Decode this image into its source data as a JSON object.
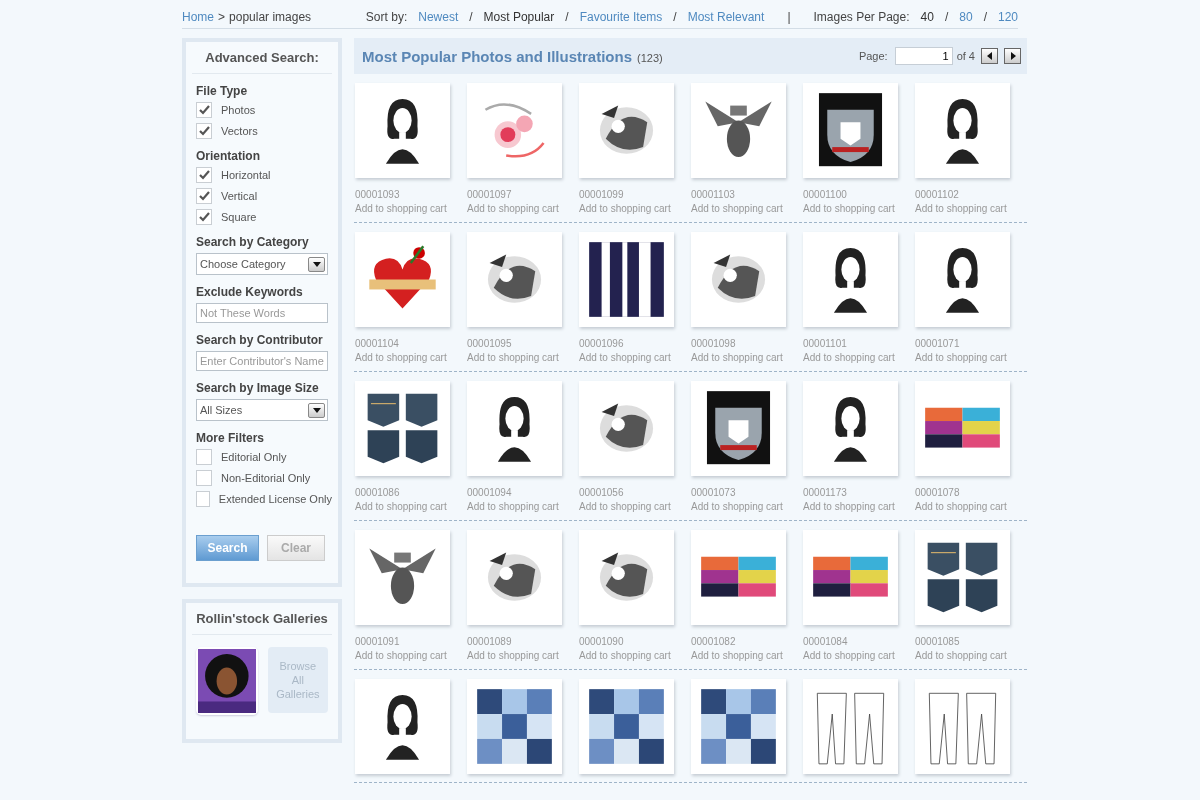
{
  "breadcrumb": {
    "home": "Home",
    "separator": ">",
    "current": "popular images"
  },
  "sort": {
    "label": "Sort by:",
    "separator": "/",
    "options": [
      {
        "label": "Newest",
        "selected": false
      },
      {
        "label": "Most Popular",
        "selected": true
      },
      {
        "label": "Favourite Items",
        "selected": false
      },
      {
        "label": "Most Relevant",
        "selected": false
      }
    ]
  },
  "divider": "|",
  "per_page": {
    "label": "Images Per Page:",
    "separator": "/",
    "options": [
      {
        "label": "40",
        "selected": true
      },
      {
        "label": "80",
        "selected": false
      },
      {
        "label": "120",
        "selected": false
      }
    ]
  },
  "sidebar": {
    "title": "Advanced Search:",
    "sections": [
      {
        "kind": "checks",
        "title": "File Type",
        "options": [
          {
            "label": "Photos",
            "checked": true
          },
          {
            "label": "Vectors",
            "checked": true
          }
        ]
      },
      {
        "kind": "checks",
        "title": "Orientation",
        "options": [
          {
            "label": "Horizontal",
            "checked": true
          },
          {
            "label": "Vertical",
            "checked": true
          },
          {
            "label": "Square",
            "checked": true
          }
        ]
      },
      {
        "kind": "select",
        "title": "Search by Category",
        "value": "Choose Category"
      },
      {
        "kind": "input",
        "title": "Exclude Keywords",
        "placeholder": "Not These Words"
      },
      {
        "kind": "input",
        "title": "Search by Contributor",
        "placeholder": "Enter Contributor's Name"
      },
      {
        "kind": "select",
        "title": "Search by Image Size",
        "value": "All Sizes"
      },
      {
        "kind": "checks",
        "title": "More Filters",
        "options": [
          {
            "label": "Editorial Only",
            "checked": false
          },
          {
            "label": "Non-Editorial Only",
            "checked": false
          },
          {
            "label": "Extended License Only",
            "checked": false
          }
        ]
      }
    ],
    "buttons": {
      "search": "Search",
      "clear": "Clear"
    }
  },
  "galleries": {
    "title": "Rollin'stock Galleries",
    "browse": "Browse All Galleries"
  },
  "main": {
    "title": "Most Popular Photos and Illustrations",
    "count": "(123)",
    "page_label": "Page:",
    "page_value": "1",
    "page_total": "of 4"
  },
  "rows": [
    {
      "items": [
        {
          "id": "00001093",
          "cart": "Add to shopping cart"
        },
        {
          "id": "00001097",
          "cart": "Add to shopping cart"
        },
        {
          "id": "00001099",
          "cart": "Add to shopping cart"
        },
        {
          "id": "00001103",
          "cart": "Add to shopping cart"
        },
        {
          "id": "00001100",
          "cart": "Add to shopping cart"
        },
        {
          "id": "00001102",
          "cart": "Add to shopping cart"
        }
      ]
    },
    {
      "items": [
        {
          "id": "00001104",
          "cart": "Add to shopping cart"
        },
        {
          "id": "00001095",
          "cart": "Add to shopping cart"
        },
        {
          "id": "00001096",
          "cart": "Add to shopping cart"
        },
        {
          "id": "00001098",
          "cart": "Add to shopping cart"
        },
        {
          "id": "00001101",
          "cart": "Add to shopping cart"
        },
        {
          "id": "00001071",
          "cart": "Add to shopping cart"
        }
      ]
    },
    {
      "items": [
        {
          "id": "00001086",
          "cart": "Add to shopping cart"
        },
        {
          "id": "00001094",
          "cart": "Add to shopping cart"
        },
        {
          "id": "00001056",
          "cart": "Add to shopping cart"
        },
        {
          "id": "00001073",
          "cart": "Add to shopping cart"
        },
        {
          "id": "00001173",
          "cart": "Add to shopping cart"
        },
        {
          "id": "00001078",
          "cart": "Add to shopping cart"
        }
      ]
    },
    {
      "items": [
        {
          "id": "00001091",
          "cart": "Add to shopping cart"
        },
        {
          "id": "00001089",
          "cart": "Add to shopping cart"
        },
        {
          "id": "00001090",
          "cart": "Add to shopping cart"
        },
        {
          "id": "00001082",
          "cart": "Add to shopping cart"
        },
        {
          "id": "00001084",
          "cart": "Add to shopping cart"
        },
        {
          "id": "00001085",
          "cart": "Add to shopping cart"
        }
      ]
    },
    {
      "items": [
        {
          "kind": "picture"
        },
        {
          "kind": "picture"
        },
        {
          "kind": "picture"
        },
        {
          "kind": "picture"
        },
        {
          "kind": "picture"
        },
        {
          "kind": "picture"
        }
      ]
    }
  ]
}
